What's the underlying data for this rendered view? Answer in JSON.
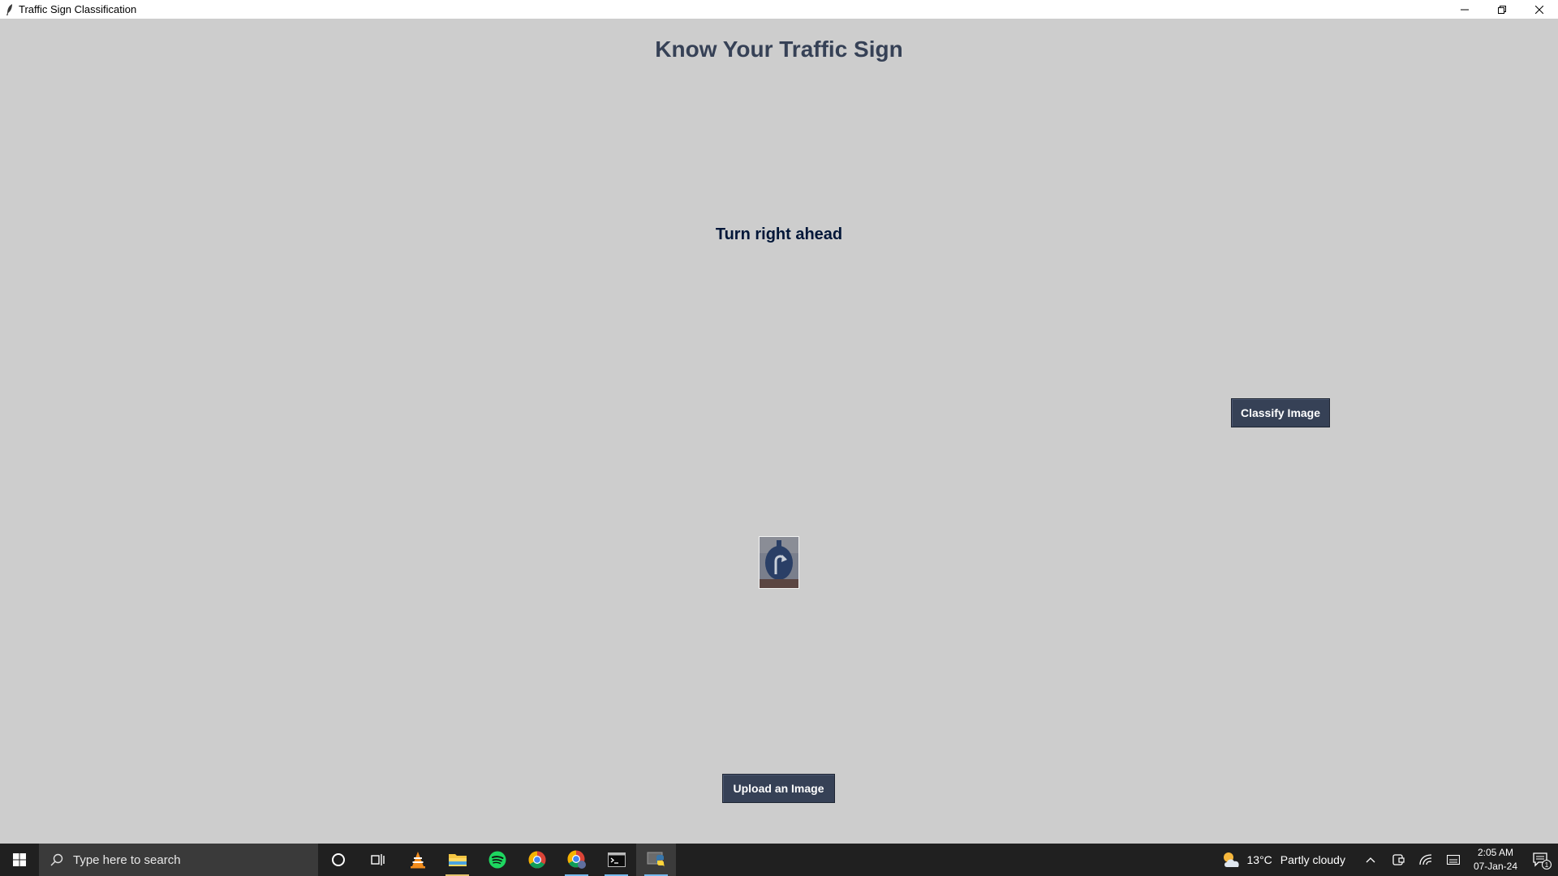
{
  "window": {
    "title": "Traffic Sign Classification",
    "icon": "feather-icon",
    "controls": [
      "minimize-icon",
      "restore-icon",
      "close-icon"
    ]
  },
  "app": {
    "heading": "Know Your Traffic Sign",
    "result": "Turn right ahead",
    "classify_button": "Classify Image",
    "upload_button": "Upload an Image",
    "thumbnail": "traffic-sign-thumbnail"
  },
  "colors": {
    "background": "#cdcdcd",
    "heading": "#364156",
    "result": "#011638",
    "button_bg": "#364156",
    "button_text": "#ffffff",
    "taskbar": "#202020"
  },
  "taskbar": {
    "search_placeholder": "Type here to search",
    "pinned": [
      "cortana-icon",
      "task-view-icon",
      "vlc-icon",
      "file-explorer-icon",
      "spotify-icon",
      "chrome-icon",
      "chrome-profile-icon",
      "terminal-icon",
      "python-icon"
    ],
    "weather": {
      "temperature": "13°C",
      "condition": "Partly cloudy"
    },
    "tray_icons": [
      "chevron-up-icon",
      "meet-now-icon",
      "wifi-icon",
      "input-indicator-icon"
    ],
    "time": "2:05 AM",
    "date": "07-Jan-24",
    "notification_count": "1"
  }
}
